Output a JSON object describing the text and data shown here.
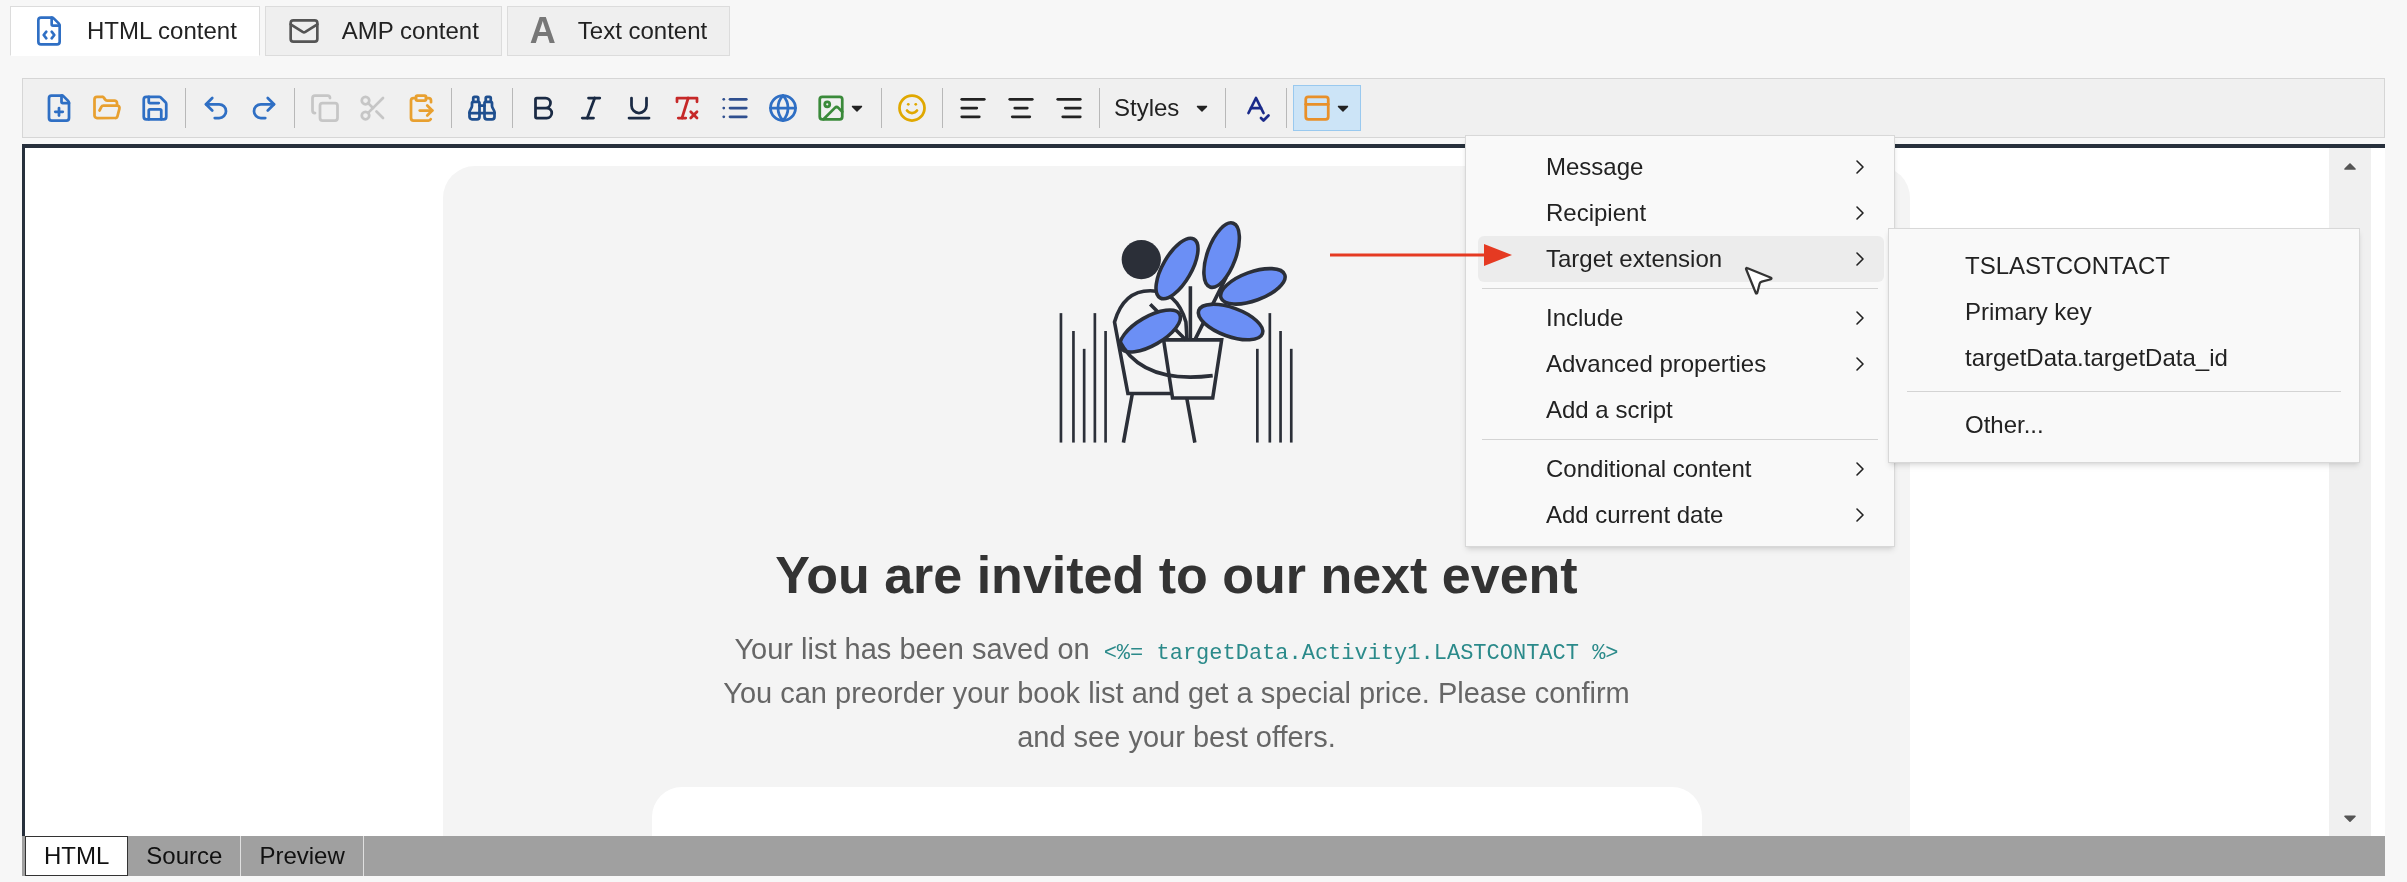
{
  "tabs": [
    {
      "kind": "html",
      "label": "HTML content",
      "selected": true
    },
    {
      "kind": "amp",
      "label": "AMP content",
      "selected": false
    },
    {
      "kind": "text",
      "glyph": "A",
      "label": "Text content",
      "selected": false
    }
  ],
  "toolbar": [
    [
      {
        "kind": "new",
        "disabled": false,
        "pressed": false
      },
      {
        "kind": "open",
        "disabled": false,
        "pressed": false
      },
      {
        "kind": "save",
        "disabled": false,
        "pressed": false
      }
    ],
    [
      {
        "kind": "undo",
        "disabled": false,
        "pressed": false
      },
      {
        "kind": "redo",
        "disabled": false,
        "pressed": false
      }
    ],
    [
      {
        "kind": "copy",
        "disabled": true,
        "pressed": false
      },
      {
        "kind": "cut",
        "disabled": true,
        "pressed": false
      },
      {
        "kind": "paste",
        "disabled": false,
        "pressed": false
      }
    ],
    [
      {
        "kind": "find",
        "disabled": false,
        "pressed": false
      }
    ],
    [
      {
        "kind": "bold",
        "disabled": false,
        "pressed": false
      },
      {
        "kind": "italic",
        "disabled": false,
        "pressed": false
      },
      {
        "kind": "underline",
        "disabled": false,
        "pressed": false
      },
      {
        "kind": "clear",
        "disabled": false,
        "pressed": false
      },
      {
        "kind": "list",
        "disabled": false,
        "pressed": false
      },
      {
        "kind": "link",
        "disabled": false,
        "pressed": false
      },
      {
        "kind": "image",
        "disabled": false,
        "pressed": false
      }
    ],
    [
      {
        "kind": "emoji",
        "disabled": false,
        "pressed": false
      }
    ],
    [
      {
        "kind": "align-left",
        "disabled": false,
        "pressed": false
      },
      {
        "kind": "align-center",
        "disabled": false,
        "pressed": false
      },
      {
        "kind": "align-right",
        "disabled": false,
        "pressed": false
      }
    ],
    [
      {
        "kind": "select",
        "label": "Styles",
        "disabled": false,
        "pressed": false
      }
    ],
    [
      {
        "kind": "spellcheck",
        "disabled": false,
        "pressed": false
      }
    ],
    [
      {
        "kind": "personalize",
        "disabled": false,
        "pressed": true
      }
    ]
  ],
  "email": {
    "heading": "You are invited to our next event",
    "saved_label": "Your list has been saved on",
    "saved_code": "<%= targetData.Activity1.LASTCONTACT %>",
    "body": "You can preorder your book list and get a special price. Please confirm and see your best offers."
  },
  "menu": {
    "items": [
      {
        "kind": "item",
        "label": "Message",
        "submenu": true,
        "selected": false
      },
      {
        "kind": "item",
        "label": "Recipient",
        "submenu": true,
        "selected": false
      },
      {
        "kind": "item",
        "label": "Target extension",
        "submenu": true,
        "selected": true
      },
      {
        "kind": "separator"
      },
      {
        "kind": "item",
        "label": "Include",
        "submenu": true,
        "selected": false
      },
      {
        "kind": "item",
        "label": "Advanced properties",
        "submenu": true,
        "selected": false
      },
      {
        "kind": "item",
        "label": "Add a script",
        "submenu": false,
        "selected": false
      },
      {
        "kind": "separator"
      },
      {
        "kind": "item",
        "label": "Conditional content",
        "submenu": true,
        "selected": false
      },
      {
        "kind": "item",
        "label": "Add current date",
        "submenu": true,
        "selected": false
      }
    ]
  },
  "submenu": {
    "items": [
      {
        "kind": "item",
        "label": "TSLASTCONTACT"
      },
      {
        "kind": "item",
        "label": "Primary key"
      },
      {
        "kind": "item",
        "label": "targetData.targetData_id"
      },
      {
        "kind": "separator"
      },
      {
        "kind": "item",
        "label": "Other..."
      }
    ]
  },
  "bottom_tabs": [
    {
      "label": "HTML",
      "selected": true
    },
    {
      "label": "Source",
      "selected": false
    },
    {
      "label": "Preview",
      "selected": false
    }
  ]
}
